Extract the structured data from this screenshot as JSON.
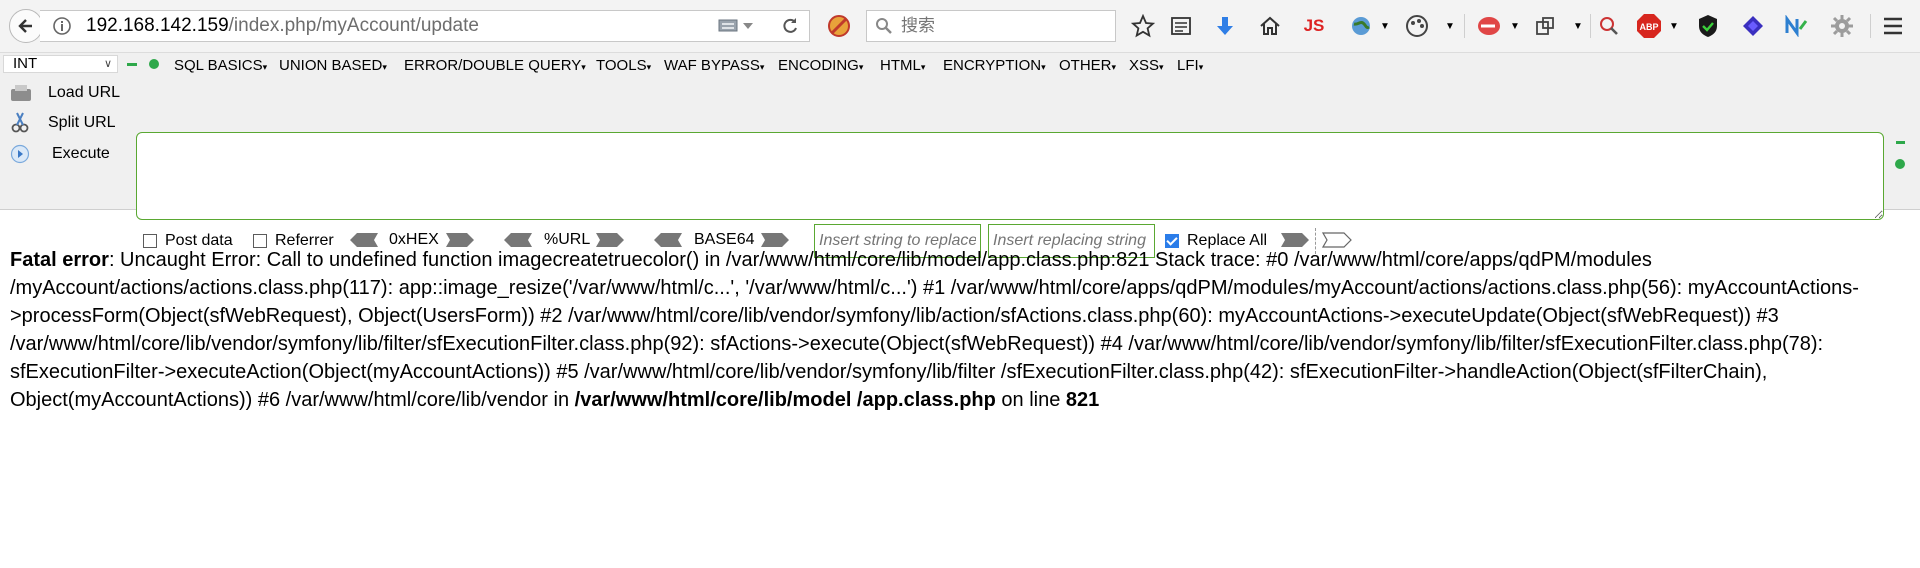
{
  "browser": {
    "url_host": "192.168.142.159",
    "url_path": "/index.php/myAccount/update",
    "search_placeholder": "搜索",
    "toolbar_icons": [
      "bookmark-star-icon",
      "reading-list-icon",
      "download-icon",
      "home-icon",
      "js-icon",
      "globe-icon",
      "theme-icon",
      "redirect-icon",
      "screenshot-icon",
      "zoom-icon",
      "adblock-icon",
      "shield-icon",
      "layers-icon",
      "n-icon",
      "gear-icon",
      "menu-icon"
    ],
    "js_label": "JS",
    "abp_label": "ABP"
  },
  "hackbar": {
    "load_type": "INT",
    "menus": [
      "SQL BASICS",
      "UNION BASED",
      "ERROR/DOUBLE QUERY",
      "TOOLS",
      "WAF BYPASS",
      "ENCODING",
      "HTML",
      "ENCRYPTION",
      "OTHER",
      "XSS",
      "LFI"
    ],
    "load_url": "Load URL",
    "split_url": "Split URL",
    "execute": "Execute",
    "post_data": "Post data",
    "referrer": "Referrer",
    "hex": "0xHEX",
    "url_enc": "%URL",
    "base64": "BASE64",
    "replace_placeholder": "Insert string to replace",
    "replacing_placeholder": "Insert replacing string",
    "replace_all": "Replace All",
    "replace_all_checked": true
  },
  "error": {
    "label": "Fatal error",
    "message": ": Uncaught Error: Call to undefined function imagecreatetruecolor() in /var/www/html/core/lib/model/app.class.php:821 Stack trace: #0 /var/www/html/core/apps/qdPM/modules /myAccount/actions/actions.class.php(117): app::image_resize('/var/www/html/c...', '/var/www/html/c...') #1 /var/www/html/core/apps/qdPM/modules/myAccount/actions/actions.class.php(56): myAccountActions->processForm(Object(sfWebRequest), Object(UsersForm)) #2 /var/www/html/core/lib/vendor/symfony/lib/action/sfActions.class.php(60): myAccountActions->executeUpdate(Object(sfWebRequest)) #3 /var/www/html/core/lib/vendor/symfony/lib/filter/sfExecutionFilter.class.php(92): sfActions->execute(Object(sfWebRequest)) #4 /var/www/html/core/lib/vendor/symfony/lib/filter/sfExecutionFilter.class.php(78): sfExecutionFilter->executeAction(Object(myAccountActions)) #5 /var/www/html/core/lib/vendor/symfony/lib/filter /sfExecutionFilter.class.php(42): sfExecutionFilter->handleAction(Object(sfFilterChain), Object(myAccountActions)) #6 /var/www/html/core/lib/vendor in ",
    "file": "/var/www/html/core/lib/model /app.class.php",
    "on_line": " on line ",
    "line": "821"
  }
}
